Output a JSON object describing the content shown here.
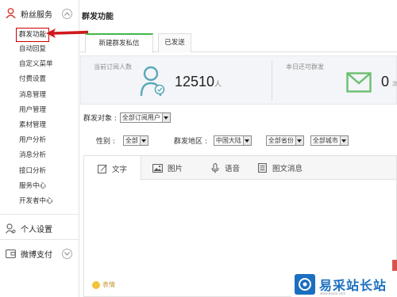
{
  "sidebar": {
    "fans_service_label": "粉丝服务",
    "items": [
      {
        "label": "群发功能",
        "active": true
      },
      {
        "label": "自动回复"
      },
      {
        "label": "自定义菜单"
      },
      {
        "label": "付费设置"
      },
      {
        "label": "消息管理"
      },
      {
        "label": "用户管理"
      },
      {
        "label": "素材管理"
      },
      {
        "label": "用户分析"
      },
      {
        "label": "消息分析"
      },
      {
        "label": "接口分析"
      },
      {
        "label": "服务中心"
      },
      {
        "label": "开发者中心"
      }
    ],
    "personal_settings_label": "个人设置",
    "weibo_pay_label": "微博支付"
  },
  "main": {
    "title": "群发功能",
    "tabs": [
      {
        "label": "新建群发私信",
        "active": true
      },
      {
        "label": "已发送"
      }
    ],
    "stats": {
      "subscribers_label": "当前订阅人数",
      "subscribers_value": "12510",
      "subscribers_unit": "人",
      "remaining_label": "本日还可群发",
      "remaining_value": "0",
      "remaining_unit": "次"
    },
    "form": {
      "target_label": "群发对象 :",
      "target_value": "全部订阅用户",
      "gender_label": "性别 :",
      "gender_value": "全部",
      "region_label": "群发地区 :",
      "country_value": "中国大陆",
      "province_value": "全部省份",
      "city_value": "全部城市"
    },
    "editor": {
      "tabs": [
        {
          "label": "文字",
          "icon": "edit-icon",
          "active": true
        },
        {
          "label": "图片",
          "icon": "image-icon"
        },
        {
          "label": "语音",
          "icon": "microphone-icon"
        },
        {
          "label": "图文消息",
          "icon": "article-icon"
        }
      ],
      "emoji_label": "表情"
    }
  },
  "watermark": {
    "brand": "易采站长站",
    "url": "www.Easck.com"
  },
  "colors": {
    "accent_green": "#44b549",
    "arrow_red": "#d0191c",
    "watermark_blue": "#1c6fc0",
    "person_icon_teal": "#5aa9b7"
  }
}
